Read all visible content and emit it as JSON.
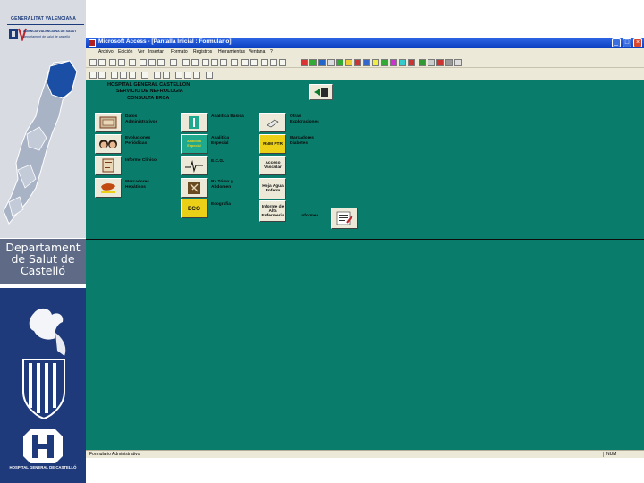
{
  "sidebar": {
    "org_title": "GENERALITAT VALENCIANA",
    "agency_line1": "AGENCIA VALENCIANA DE SALUT",
    "agency_line2": "departament de salut de castelló",
    "department_label": "Departament de Salut de Castelló",
    "hospital_caption": "HOSPITAL GENERAL DE CASTELLÓ"
  },
  "window": {
    "title": "Microsoft Access - [Pantalla Inicial : Formulario]",
    "minimize_label": "_",
    "maximize_label": "□",
    "close_label": "×"
  },
  "menu": [
    "Archivo",
    "Edición",
    "Ver",
    "Insertar",
    "Formato",
    "Registros",
    "Herramientas",
    "Ventana",
    "?"
  ],
  "form": {
    "header_line1": "HOSPITAL GENERAL CASTELLON",
    "header_line2": "SERVICIO DE NEFROLOGIA",
    "header_line3": "CONSULTA ERCA",
    "items": {
      "datos_admin": "Datos Administrativos",
      "analitica_basica": "Analitica Basica",
      "otras_exploraciones": "Otras Exploraciones",
      "evoluciones": "Evoluciones Periódicas",
      "analitica_especial": "Analitica Especial",
      "analitica_especial_btn": "Analitica Especial",
      "marcadores_diabetes": "Marcadores Diabetes",
      "rnm_label": "RNM PTR",
      "informe_clinico": "Informe Clinico",
      "ecg": "E.C.G.",
      "acceso_vascular": "Acceso Vascular",
      "acceso_vascular_btn": "Acceso Vascular",
      "marcadores_hepaticos": "Marcadores Hepáticos",
      "rx_torax": "Rx Tórax y Abdomen",
      "hoja_agua": "Hoja Agua Enferm",
      "ecografia": "Ecografia",
      "eco_btn": "ECO",
      "informe_alta": "Informe de Alta Enfermeria",
      "informes": "Informes"
    }
  },
  "statusbar": {
    "left_text": "Formulario Administrativo",
    "right_text": "NUM"
  },
  "colors": {
    "form_background": "#0a7c6c",
    "sidebar_navy": "#1f3a7a",
    "sidebar_gray": "#5f6b86",
    "titlebar_blue": "#1b52d6"
  }
}
